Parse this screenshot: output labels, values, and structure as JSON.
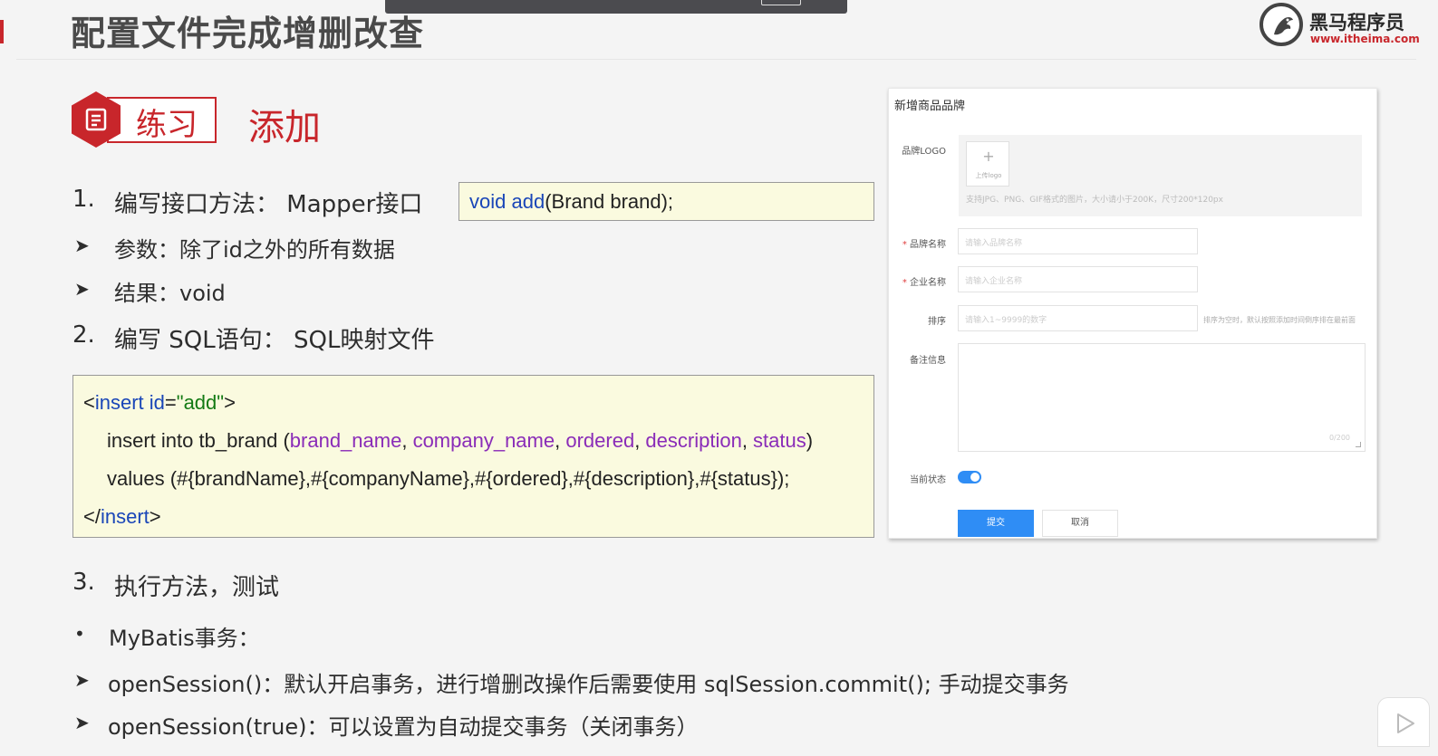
{
  "header": {
    "title": "配置文件完成增删改查",
    "brand_name": "黑马程序员",
    "brand_url": "www.itheima.com"
  },
  "practice": {
    "badge": "练习",
    "heading": "添加"
  },
  "steps": [
    {
      "num": "1.",
      "text": "编写接口方法：  Mapper接口"
    },
    {
      "num": "2.",
      "text": "编写 SQL语句：  SQL映射文件"
    },
    {
      "num": "3.",
      "text": "执行方法，测试"
    }
  ],
  "step1_bullets": [
    "参数：除了id之外的所有数据",
    "结果：void"
  ],
  "interface_code": {
    "kw": "void add",
    "rest": "(Brand brand);"
  },
  "sql_code": {
    "line1_open": "<",
    "line1_kw": "insert id",
    "line1_eq": "=",
    "line1_str": "\"add\"",
    "line1_close": ">",
    "line2_pre": "insert into tb_brand (",
    "line2_cols": [
      "brand_name",
      "company_name",
      "ordered",
      "description",
      "status"
    ],
    "line2_post": ")",
    "line3": "values (#{brandName},#{companyName},#{ordered},#{description},#{status});",
    "line4_open": "</",
    "line4_kw": "insert",
    "line4_close": ">"
  },
  "transaction": {
    "heading": "MyBatis事务：",
    "items": [
      "openSession()：默认开启事务，进行增删改操作后需要使用 sqlSession.commit(); 手动提交事务",
      "openSession(true)：可以设置为自动提交事务（关闭事务）"
    ]
  },
  "form": {
    "title": "新增商品品牌",
    "logo_label": "品牌LOGO",
    "upload_plus": "+",
    "upload_text": "上传logo",
    "upload_hint": "支持JPG、PNG、GIF格式的图片，大小请小于200K，尺寸200*120px",
    "brand_label": "品牌名称",
    "brand_placeholder": "请输入品牌名称",
    "company_label": "企业名称",
    "company_placeholder": "请输入企业名称",
    "order_label": "排序",
    "order_placeholder": "请输入1~9999的数字",
    "order_hint": "排序为空时，默认按照添加时间倒序排在最前面",
    "desc_label": "备注信息",
    "desc_counter": "0/200",
    "status_label": "当前状态",
    "status_on": true,
    "submit": "提交",
    "cancel": "取消"
  },
  "colors": {
    "accent": "#c8262b",
    "keyword": "#1a46b8",
    "string": "#137a13",
    "column": "#8a2cb8",
    "primary_button": "#2f8df5",
    "code_background": "#fafadf"
  }
}
